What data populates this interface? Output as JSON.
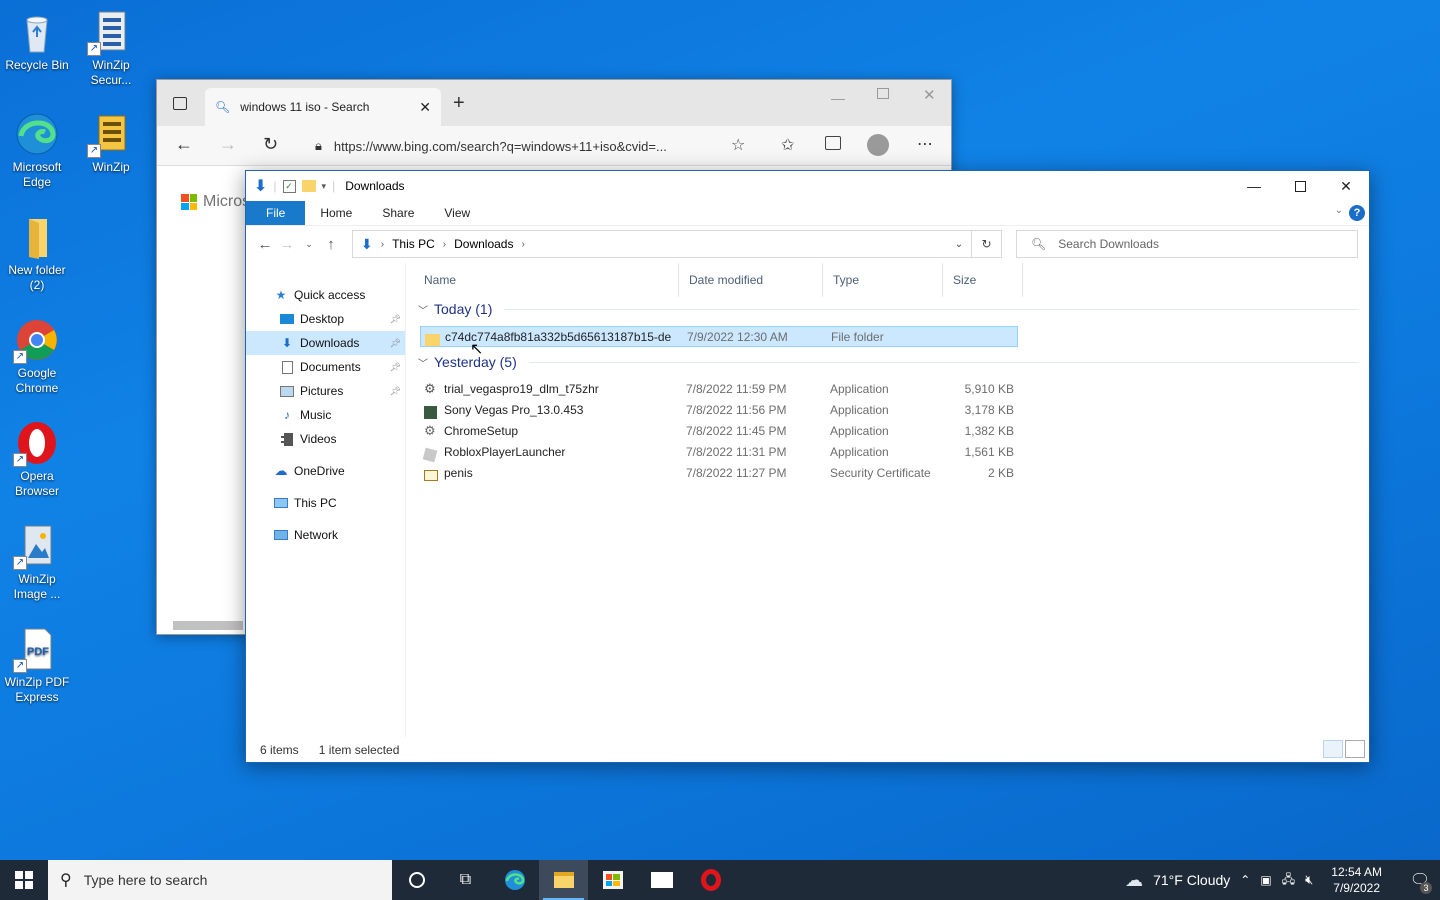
{
  "desktop": {
    "icons": [
      {
        "label": "Recycle Bin",
        "icon": "recycle-bin-icon"
      },
      {
        "label": "WinZip Secur...",
        "icon": "winzip-secure-icon"
      },
      {
        "label": "Microsoft Edge",
        "icon": "edge-icon"
      },
      {
        "label": "WinZip",
        "icon": "winzip-icon"
      },
      {
        "label": "New folder (2)",
        "icon": "folder-icon"
      },
      {
        "label": "Google Chrome",
        "icon": "chrome-icon"
      },
      {
        "label": "Opera Browser",
        "icon": "opera-icon"
      },
      {
        "label": "WinZip Image ...",
        "icon": "winzip-image-icon"
      },
      {
        "label": "WinZip PDF Express",
        "icon": "winzip-pdf-icon"
      }
    ]
  },
  "browser": {
    "tab_title": "windows 11 iso - Search",
    "url": "https://www.bing.com/search?q=windows+11+iso&cvid=...",
    "page_logo_text": "Micros"
  },
  "explorer": {
    "title": "Downloads",
    "ribbon_tabs": [
      "File",
      "Home",
      "Share",
      "View"
    ],
    "breadcrumb": [
      "This PC",
      "Downloads"
    ],
    "search_placeholder": "Search Downloads",
    "nav": {
      "quick_access": "Quick access",
      "desktop": "Desktop",
      "downloads": "Downloads",
      "documents": "Documents",
      "pictures": "Pictures",
      "music": "Music",
      "videos": "Videos",
      "onedrive": "OneDrive",
      "this_pc": "This PC",
      "network": "Network"
    },
    "columns": {
      "name": "Name",
      "date": "Date modified",
      "type": "Type",
      "size": "Size"
    },
    "groups": [
      {
        "label": "Today (1)",
        "files": [
          {
            "name": "c74dc774a8fb81a332b5d65613187b15-de...",
            "date": "7/9/2022 12:30 AM",
            "type": "File folder",
            "size": "",
            "icon": "folder-icon"
          }
        ]
      },
      {
        "label": "Yesterday (5)",
        "files": [
          {
            "name": "trial_vegaspro19_dlm_t75zhr",
            "date": "7/8/2022 11:59 PM",
            "type": "Application",
            "size": "5,910 KB",
            "icon": "installer-icon"
          },
          {
            "name": "Sony Vegas Pro_13.0.453",
            "date": "7/8/2022 11:56 PM",
            "type": "Application",
            "size": "3,178 KB",
            "icon": "vegas-icon"
          },
          {
            "name": "ChromeSetup",
            "date": "7/8/2022 11:45 PM",
            "type": "Application",
            "size": "1,382 KB",
            "icon": "setup-icon"
          },
          {
            "name": "RobloxPlayerLauncher",
            "date": "7/8/2022 11:31 PM",
            "type": "Application",
            "size": "1,561 KB",
            "icon": "roblox-icon"
          },
          {
            "name": "penis",
            "date": "7/8/2022 11:27 PM",
            "type": "Security Certificate",
            "size": "2 KB",
            "icon": "certificate-icon"
          }
        ]
      }
    ],
    "status": {
      "items": "6 items",
      "selected": "1 item selected"
    }
  },
  "taskbar": {
    "search_placeholder": "Type here to search",
    "weather": "71°F  Cloudy",
    "time": "12:54 AM",
    "date": "7/9/2022",
    "notification_count": "3"
  }
}
